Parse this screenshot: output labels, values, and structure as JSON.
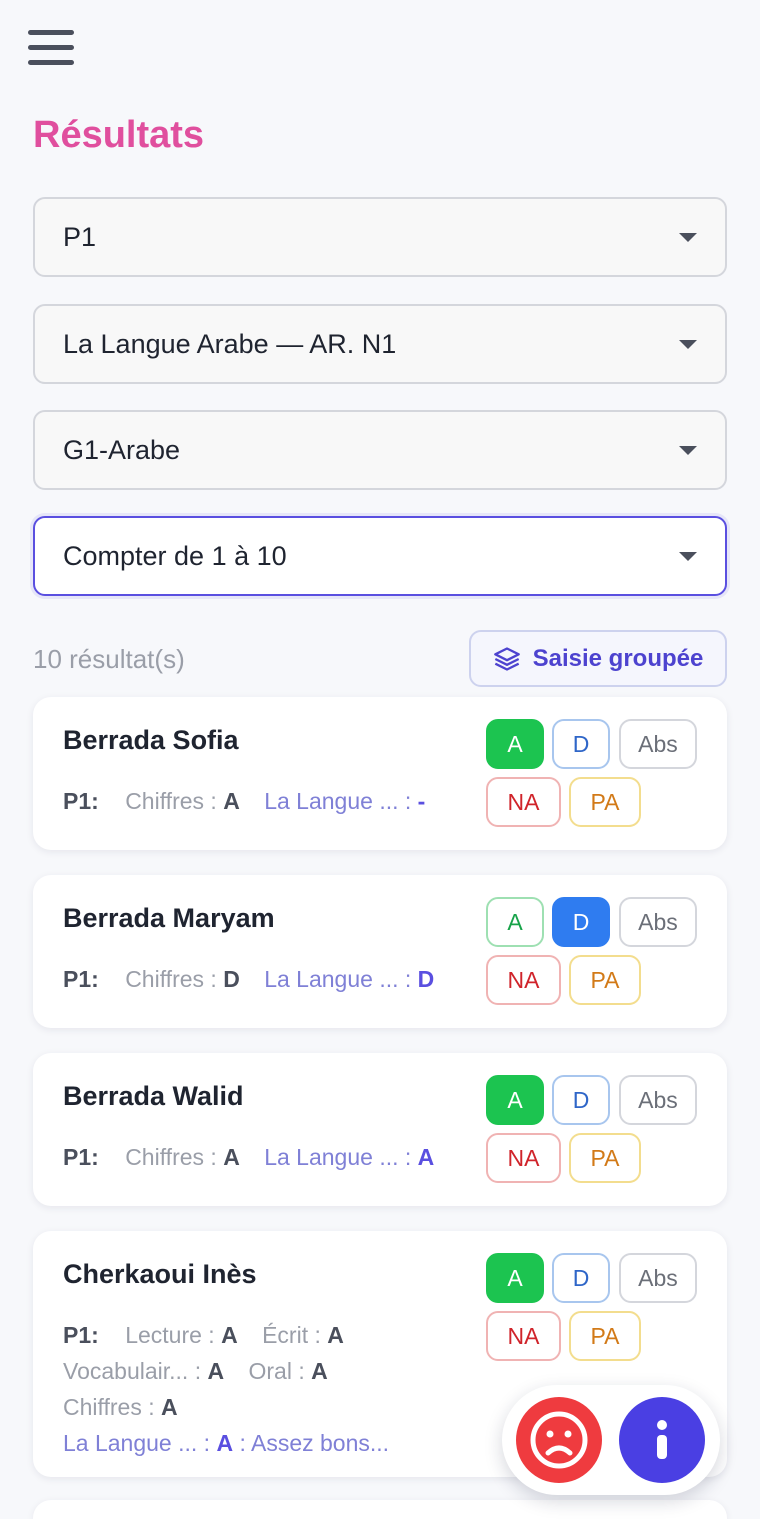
{
  "header": {
    "title": "Résultats"
  },
  "filters": [
    {
      "value": "P1"
    },
    {
      "value": "La Langue Arabe — AR. N1"
    },
    {
      "value": "G1-Arabe"
    },
    {
      "value": "Compter de 1 à 10"
    }
  ],
  "results": {
    "count_label": "10 résultat(s)",
    "group_button_label": "Saisie groupée"
  },
  "buttons": {
    "a": "A",
    "d": "D",
    "abs": "Abs",
    "na": "NA",
    "pa": "PA"
  },
  "students": [
    {
      "name": "Berrada Sofia",
      "period": "P1:",
      "grades": [
        {
          "label": "Chiffres : ",
          "value": "A"
        }
      ],
      "lang": {
        "label": "La Langue ... : ",
        "value": "-"
      },
      "selected": "A"
    },
    {
      "name": "Berrada Maryam",
      "period": "P1:",
      "grades": [
        {
          "label": "Chiffres : ",
          "value": "D"
        }
      ],
      "lang": {
        "label": "La Langue ... : ",
        "value": "D"
      },
      "selected": "D"
    },
    {
      "name": "Berrada Walid",
      "period": "P1:",
      "grades": [
        {
          "label": "Chiffres : ",
          "value": "A"
        }
      ],
      "lang": {
        "label": "La Langue ... : ",
        "value": "A"
      },
      "selected": "A"
    },
    {
      "name": "Cherkaoui Inès",
      "period": "P1:",
      "grades": [
        {
          "label": "Lecture : ",
          "value": "A"
        },
        {
          "label": "Écrit : ",
          "value": "A"
        },
        {
          "label": "Vocabulair... : ",
          "value": "A"
        },
        {
          "label": "Oral : ",
          "value": "A"
        },
        {
          "label": "Chiffres : ",
          "value": "A"
        }
      ],
      "lang": {
        "label": "La Langue ... : ",
        "value": "A",
        "comment": " : Assez bons..."
      },
      "selected": "A"
    }
  ],
  "icons": {
    "menu": "hamburger-icon",
    "layers": "layers-icon",
    "sad": "sad-face-icon",
    "info": "info-icon"
  },
  "colors": {
    "title": "#e04f9e",
    "accent": "#5a4fe0",
    "green": "#1cc450",
    "blue": "#2f7cf0",
    "red": "#ef3b3f"
  }
}
